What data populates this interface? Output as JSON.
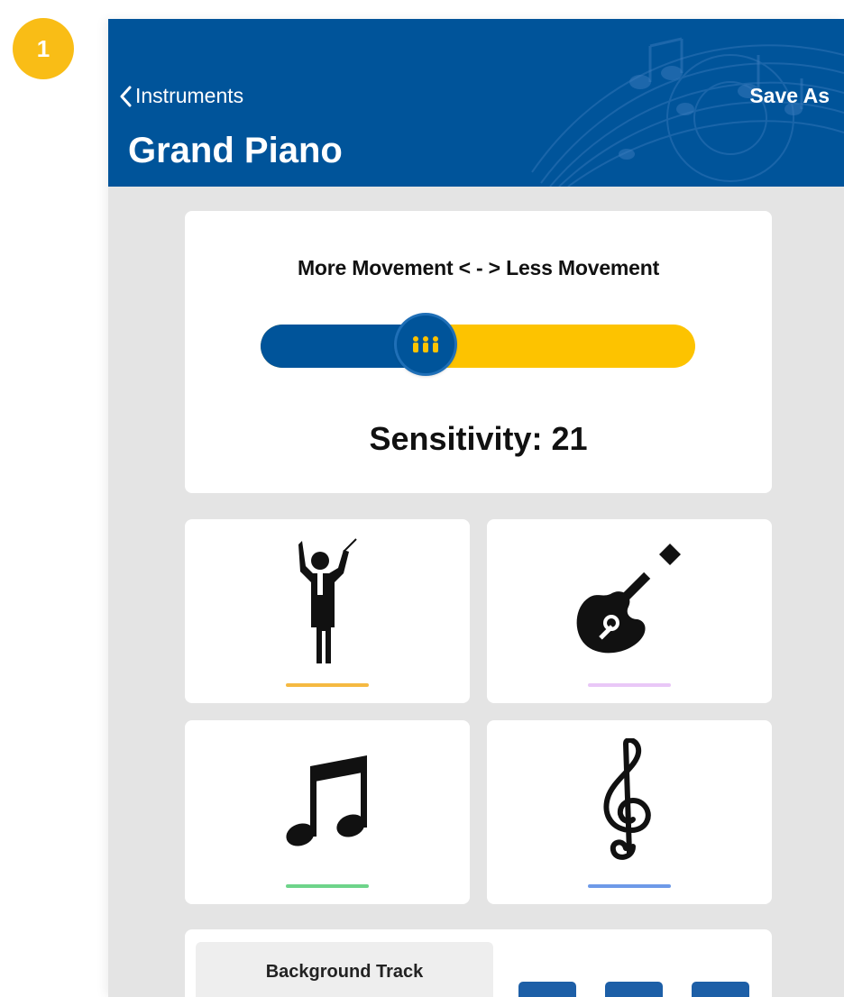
{
  "step_badge": "1",
  "nav": {
    "back_label": "Instruments",
    "action_label": "Save As",
    "title": "Grand Piano"
  },
  "sensitivity": {
    "range_label": "More Movement < - > Less Movement",
    "value_text": "Sensitivity: 21",
    "slider_fraction": 0.38
  },
  "instrument_tiles": [
    {
      "icon": "conductor-icon",
      "underline_color": "#f5b942"
    },
    {
      "icon": "guitar-icon",
      "underline_color": "#e9c7f7"
    },
    {
      "icon": "music-notes-icon",
      "underline_color": "#6ed48a"
    },
    {
      "icon": "treble-clef-icon",
      "underline_color": "#6e9ae8"
    }
  ],
  "background_track": {
    "label": "Background Track"
  },
  "colors": {
    "brand_blue": "#00549a",
    "accent_yellow": "#fdc300",
    "badge_yellow": "#f9bd16",
    "screen_bg": "#e4e4e4"
  }
}
